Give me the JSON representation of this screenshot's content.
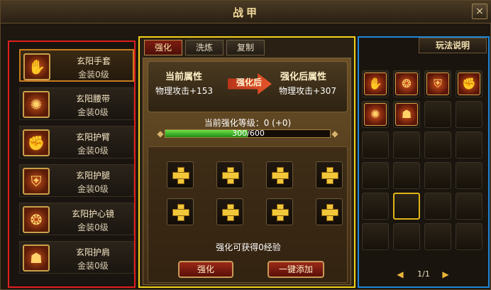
{
  "window": {
    "title": "战甲",
    "close_icon": "×"
  },
  "equipment": [
    {
      "name": "玄阳手套",
      "grade": "金装0级",
      "icon": "gauntlet-icon",
      "glyph": "✋",
      "selected": true
    },
    {
      "name": "玄阳腰带",
      "grade": "金装0级",
      "icon": "belt-icon",
      "glyph": "✺",
      "selected": false
    },
    {
      "name": "玄阳护臂",
      "grade": "金装0级",
      "icon": "bracer-icon",
      "glyph": "✊",
      "selected": false
    },
    {
      "name": "玄阳护腿",
      "grade": "金装0级",
      "icon": "leg-guard-icon",
      "glyph": "⛨",
      "selected": false
    },
    {
      "name": "玄阳护心镜",
      "grade": "金装0级",
      "icon": "chest-mirror-icon",
      "glyph": "❂",
      "selected": false
    },
    {
      "name": "玄阳护肩",
      "grade": "金装0级",
      "icon": "shoulder-guard-icon",
      "glyph": "☗",
      "selected": false
    }
  ],
  "tabs": [
    {
      "label": "强化",
      "active": true
    },
    {
      "label": "洗炼",
      "active": false
    },
    {
      "label": "复制",
      "active": false
    }
  ],
  "enhance": {
    "current_label": "当前属性",
    "current_value": "物理攻击+153",
    "after_label": "强化后属性",
    "after_value": "物理攻击+307",
    "arrow_label": "强化后",
    "level_text": "当前强化等级：0 (+0)",
    "progress_text": "300/600",
    "progress": 0.5,
    "slot_count": 8,
    "exp_text": "强化可获得0经验",
    "enhance_button": "强化",
    "auto_add_button": "一键添加"
  },
  "bag": {
    "help_label": "玩法说明",
    "items": [
      {
        "icon": "gauntlet-icon",
        "glyph": "✋"
      },
      {
        "icon": "chest-mirror-icon",
        "glyph": "❂"
      },
      {
        "icon": "leg-guard-icon",
        "glyph": "⛨"
      },
      {
        "icon": "bracer-icon",
        "glyph": "✊"
      },
      {
        "icon": "belt-icon",
        "glyph": "✺"
      },
      {
        "icon": "shoulder-guard-icon",
        "glyph": "☗"
      }
    ],
    "total_slots": 24,
    "highlight_slot": 17,
    "page_text": "1/1"
  }
}
